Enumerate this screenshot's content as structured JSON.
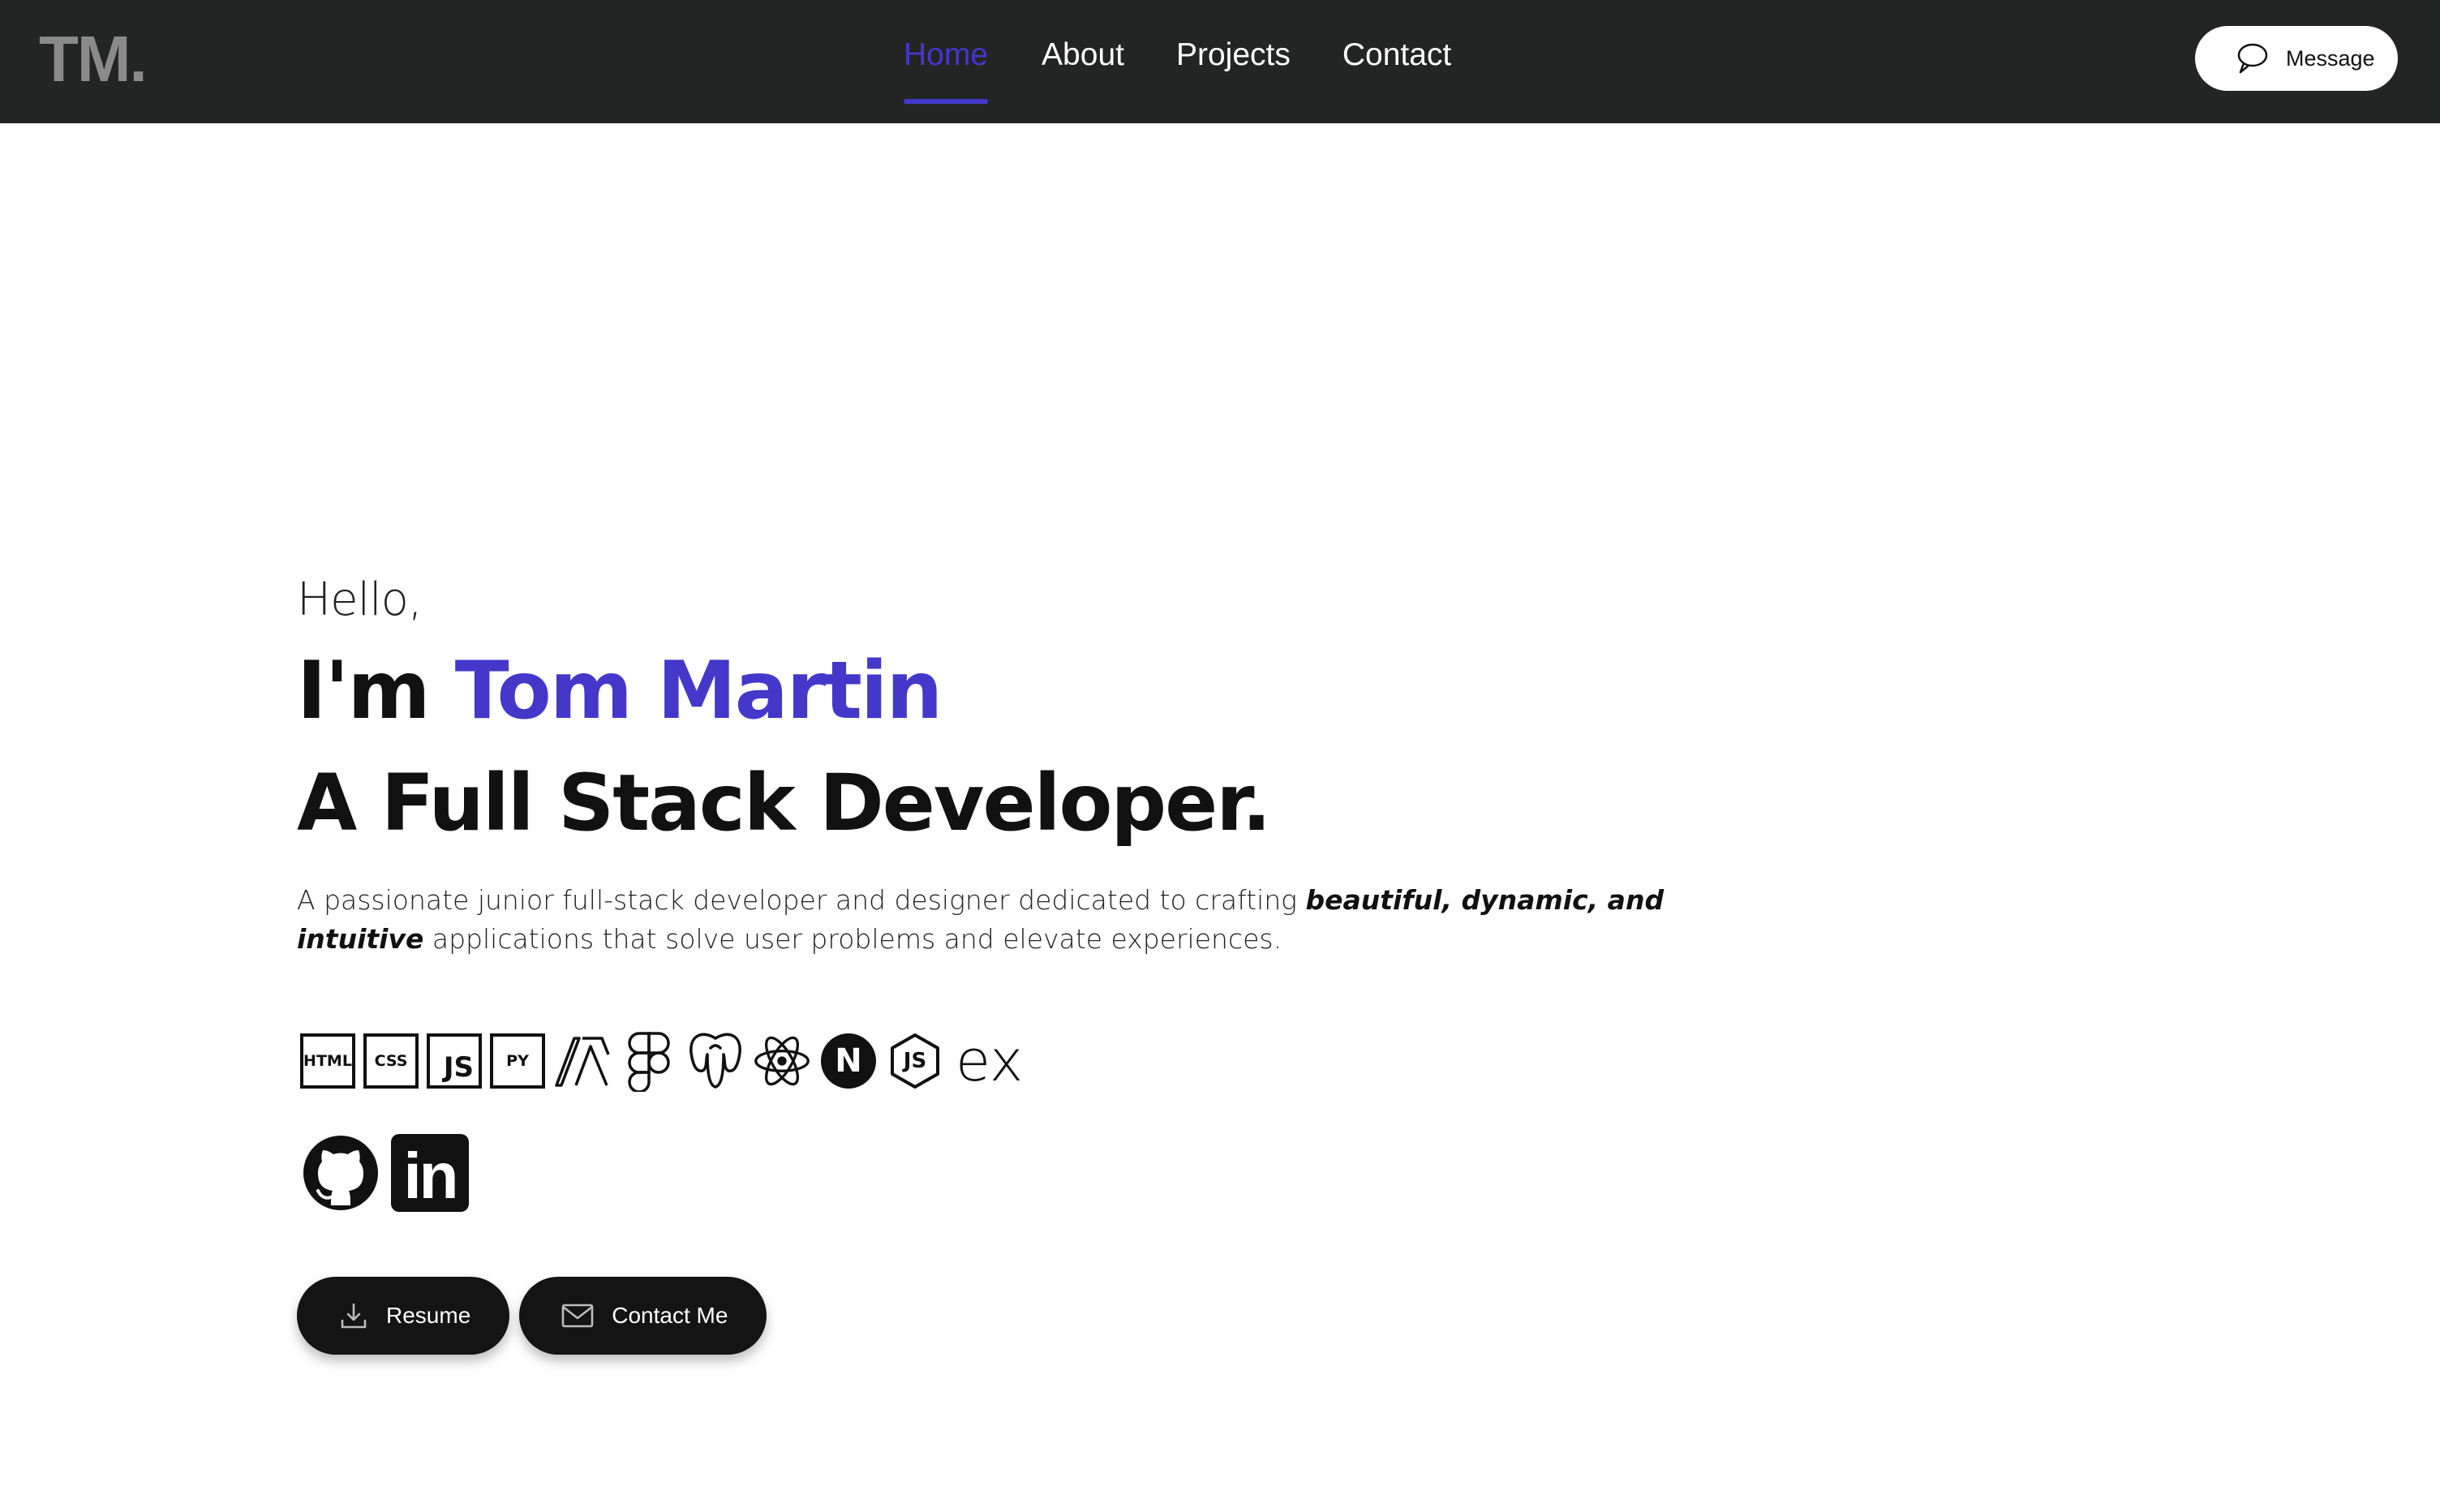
{
  "header": {
    "logo": "TM.",
    "nav": [
      {
        "label": "Home",
        "active": true
      },
      {
        "label": "About",
        "active": false
      },
      {
        "label": "Projects",
        "active": false
      },
      {
        "label": "Contact",
        "active": false
      }
    ],
    "message_button": {
      "label": "Message",
      "icon": "speech-bubble-icon"
    }
  },
  "hero": {
    "greeting": "Hello,",
    "intro_prefix": "I'm ",
    "name": "Tom Martin",
    "role": "A Full Stack Developer.",
    "description_start": "A passionate junior full-stack developer and designer dedicated to crafting ",
    "description_emphasis": "beautiful, dynamic, and intuitive",
    "description_end": " applications that solve user problems and elevate experiences."
  },
  "tech_stack": [
    {
      "name": "html-icon",
      "text": "HTML"
    },
    {
      "name": "css-icon",
      "text": "CSS"
    },
    {
      "name": "javascript-icon",
      "text": "JS"
    },
    {
      "name": "python-icon",
      "text": "PY"
    },
    {
      "name": "angular-icon"
    },
    {
      "name": "figma-icon"
    },
    {
      "name": "postgresql-icon"
    },
    {
      "name": "react-icon"
    },
    {
      "name": "nextjs-icon",
      "text": "N"
    },
    {
      "name": "nodejs-icon",
      "text": "JS"
    },
    {
      "name": "express-icon",
      "text": "ex"
    }
  ],
  "social": [
    {
      "name": "github-icon"
    },
    {
      "name": "linkedin-icon",
      "text": "in"
    }
  ],
  "buttons": {
    "resume": {
      "label": "Resume",
      "icon": "download-icon"
    },
    "contact": {
      "label": "Contact Me",
      "icon": "mail-icon"
    }
  },
  "colors": {
    "accent": "#4338ca",
    "header_bg": "#232424",
    "button_bg": "#141414"
  }
}
